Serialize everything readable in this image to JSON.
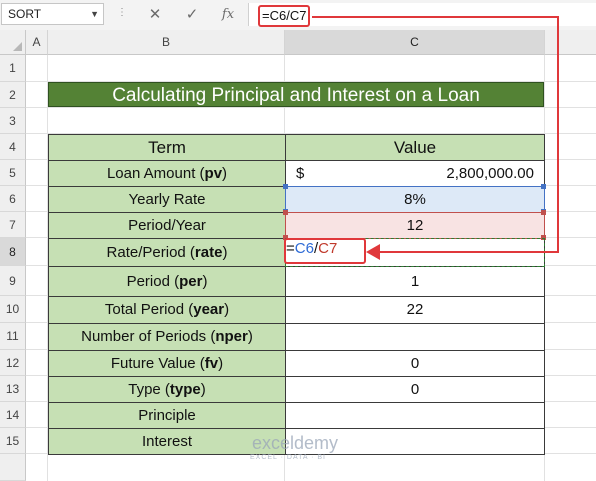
{
  "formula_bar": {
    "name_box": "SORT",
    "cancel_icon": "✕",
    "enter_icon": "✓",
    "fx_label": "fx",
    "formula": "=C6/C7"
  },
  "columns": [
    "A",
    "B",
    "C"
  ],
  "rows": [
    "1",
    "2",
    "3",
    "4",
    "5",
    "6",
    "7",
    "8",
    "9",
    "10",
    "11",
    "12",
    "13",
    "14",
    "15"
  ],
  "title": "Calculating Principal and Interest on a Loan",
  "table": {
    "header_term": "Term",
    "header_value": "Value",
    "rows": [
      {
        "pre": "Loan Amount (",
        "key": "pv",
        "post": ")",
        "value": "",
        "currency": "$",
        "amount": "2,800,000.00"
      },
      {
        "pre": "Yearly Rate",
        "key": "",
        "post": "",
        "value": "8%"
      },
      {
        "pre": "Period/Year",
        "key": "",
        "post": "",
        "value": "12"
      },
      {
        "pre": "Rate/Period (",
        "key": "rate",
        "post": ")",
        "value": ""
      },
      {
        "pre": "Period (",
        "key": "per",
        "post": ")",
        "value": "1"
      },
      {
        "pre": "Total Period (",
        "key": "year",
        "post": ")",
        "value": "22"
      },
      {
        "pre": "Number of Periods (",
        "key": "nper",
        "post": ")",
        "value": ""
      },
      {
        "pre": "Future Value (",
        "key": "fv",
        "post": ")",
        "value": "0"
      },
      {
        "pre": "Type (",
        "key": "type",
        "post": ")",
        "value": "0"
      },
      {
        "pre": "Principle",
        "key": "",
        "post": "",
        "value": ""
      },
      {
        "pre": "Interest",
        "key": "",
        "post": "",
        "value": ""
      }
    ]
  },
  "editing_cell": {
    "eq": "=",
    "ref1": "C6",
    "slash": "/",
    "ref2": "C7"
  },
  "watermark": {
    "name": "exceldemy",
    "tagline": "EXCEL · DATA · BI"
  },
  "colors": {
    "title_bg": "#548235",
    "term_bg": "#c6e0b4",
    "ref_blue": "#2e6bd6",
    "ref_red": "#c0392b",
    "callout_red": "#e0383b"
  }
}
